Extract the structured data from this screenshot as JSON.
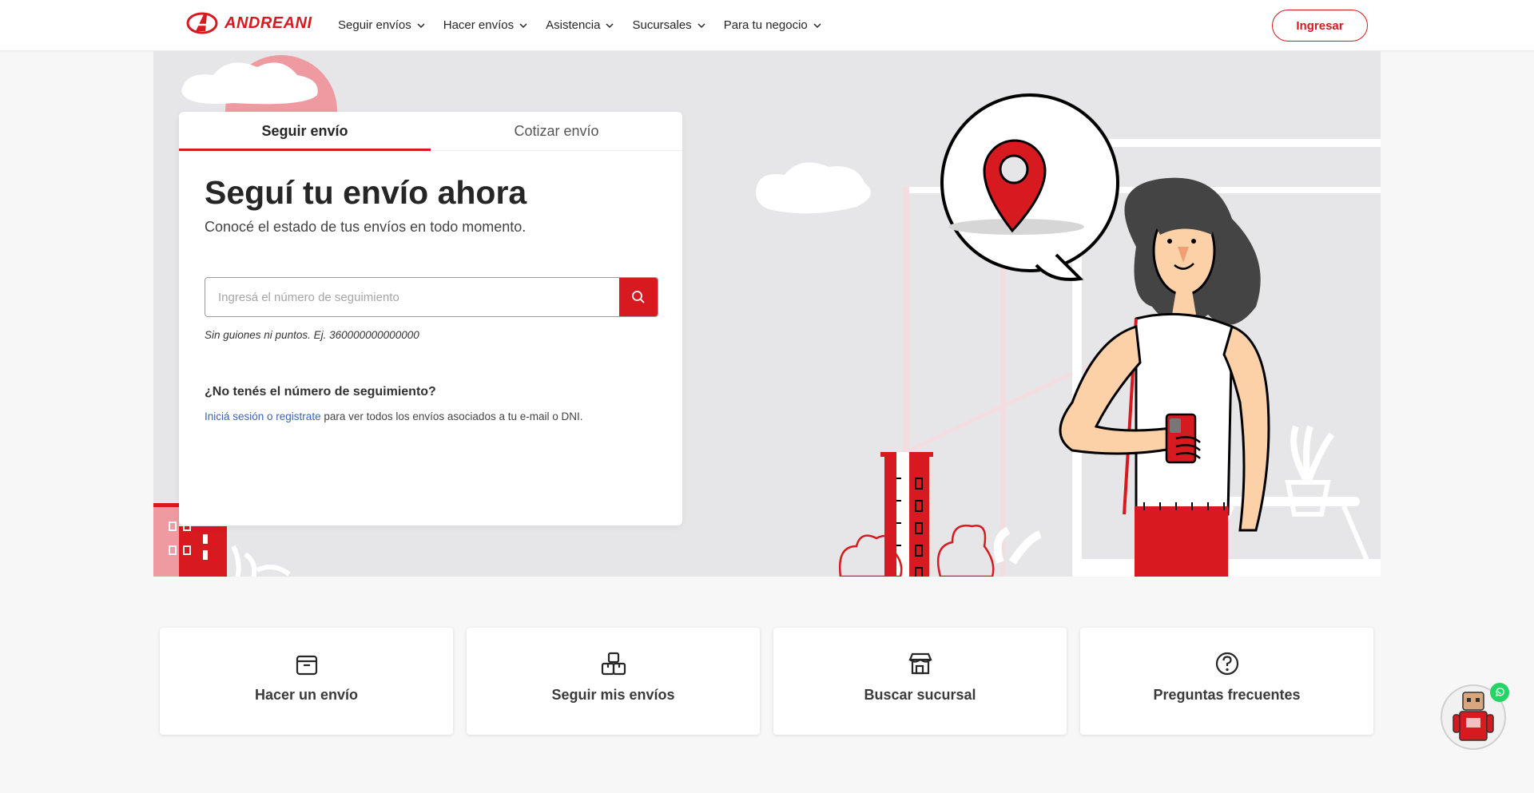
{
  "brand": {
    "name": "ANDREANI",
    "color": "#d71920"
  },
  "nav": {
    "items": [
      {
        "label": "Seguir envíos"
      },
      {
        "label": "Hacer envíos"
      },
      {
        "label": "Asistencia"
      },
      {
        "label": "Sucursales"
      },
      {
        "label": "Para tu negocio"
      }
    ],
    "login_label": "Ingresar"
  },
  "tracking": {
    "tabs": [
      {
        "label": "Seguir envío",
        "active": true
      },
      {
        "label": "Cotizar envío",
        "active": false
      }
    ],
    "title": "Seguí tu envío ahora",
    "subtitle": "Conocé el estado de tus envíos en todo momento.",
    "search_placeholder": "Ingresá el número de seguimiento",
    "hint": "Sin guiones ni puntos. Ej. 360000000000000",
    "no_number_title": "¿No tenés el número de seguimiento?",
    "login_link": "Iniciá sesión o registrate",
    "login_rest": " para ver todos los envíos asociados a tu e-mail o DNI."
  },
  "quick_links": [
    {
      "label": "Hacer un envío",
      "icon": "box-icon"
    },
    {
      "label": "Seguir mis envíos",
      "icon": "boxes-icon"
    },
    {
      "label": "Buscar sucursal",
      "icon": "store-icon"
    },
    {
      "label": "Preguntas frecuentes",
      "icon": "question-icon"
    }
  ],
  "icons": {
    "search": "search-icon",
    "chevron": "chevron-down-icon",
    "chat": "whatsapp-icon"
  }
}
